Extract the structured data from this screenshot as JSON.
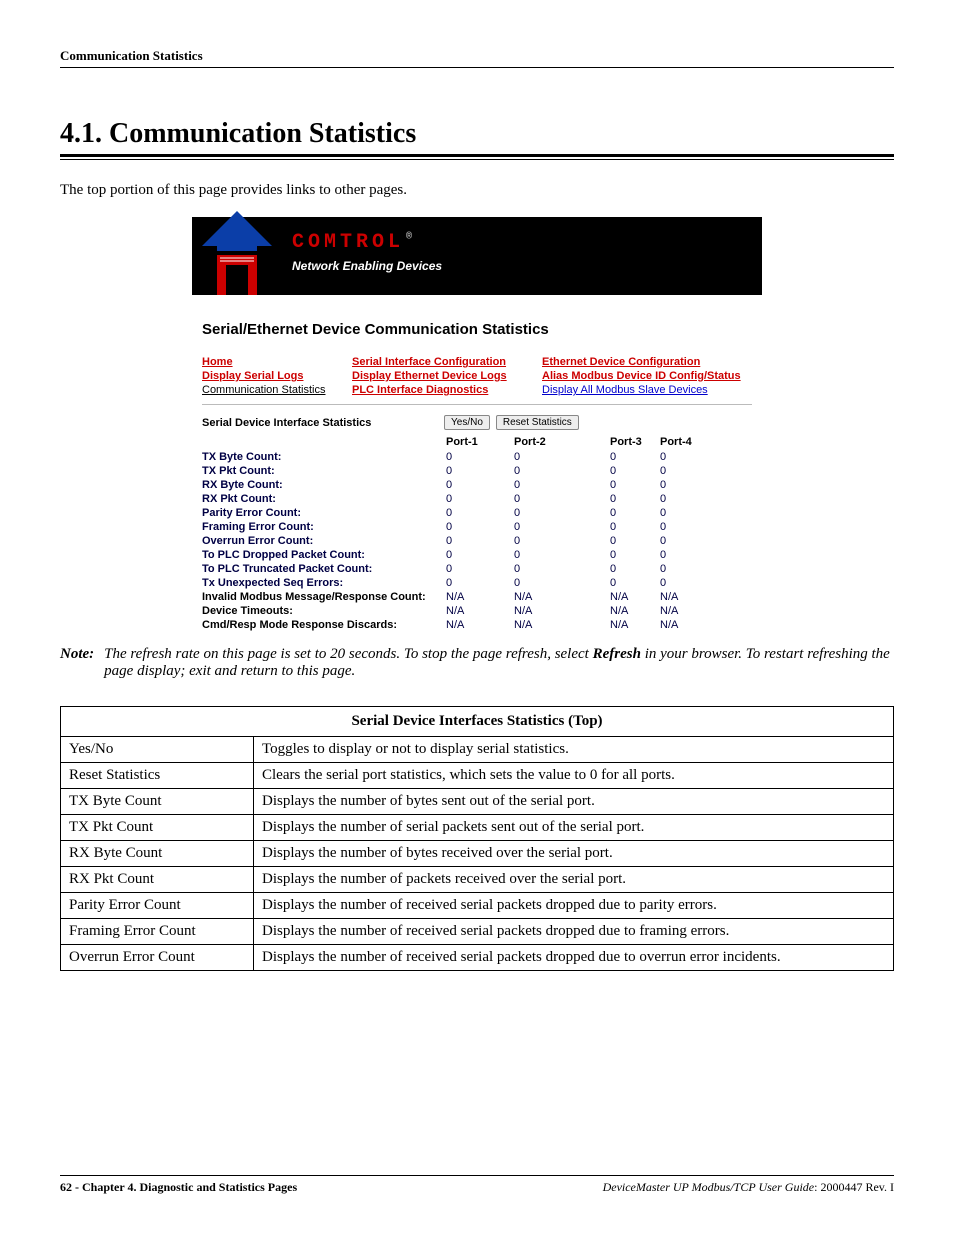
{
  "header": {
    "running_title": "Communication Statistics"
  },
  "section": {
    "number": "4.1.",
    "title": "Communication Statistics",
    "intro": "The top portion of this page provides links to other pages."
  },
  "screenshot": {
    "brand_text": "COMTROL",
    "brand_tagline": "Network Enabling Devices",
    "page_heading": "Serial/Ethernet Device Communication Statistics",
    "nav": {
      "home": "Home",
      "sic": "Serial Interface Configuration",
      "edc": "Ethernet Device Configuration",
      "dsl": "Display Serial Logs",
      "dedl": "Display Ethernet Device Logs",
      "amdi": "Alias Modbus Device ID Config/Status",
      "cs": "Communication Statistics",
      "pid": "PLC Interface Diagnostics",
      "damsd": "Display All Modbus Slave Devices"
    },
    "stats_title": "Serial Device Interface Statistics",
    "btn_yesno": "Yes/No",
    "btn_reset": "Reset Statistics",
    "ports": [
      "Port-1",
      "Port-2",
      "Port-3",
      "Port-4"
    ],
    "rows": [
      {
        "label": "TX Byte Count:",
        "v": [
          "0",
          "0",
          "0",
          "0"
        ]
      },
      {
        "label": "TX Pkt Count:",
        "v": [
          "0",
          "0",
          "0",
          "0"
        ]
      },
      {
        "label": "RX Byte Count:",
        "v": [
          "0",
          "0",
          "0",
          "0"
        ]
      },
      {
        "label": "RX Pkt Count:",
        "v": [
          "0",
          "0",
          "0",
          "0"
        ]
      },
      {
        "label": "Parity Error Count:",
        "v": [
          "0",
          "0",
          "0",
          "0"
        ]
      },
      {
        "label": "Framing Error Count:",
        "v": [
          "0",
          "0",
          "0",
          "0"
        ]
      },
      {
        "label": "Overrun Error Count:",
        "v": [
          "0",
          "0",
          "0",
          "0"
        ]
      },
      {
        "label": "To PLC Dropped Packet Count:",
        "v": [
          "0",
          "0",
          "0",
          "0"
        ]
      },
      {
        "label": "To PLC Truncated Packet Count:",
        "v": [
          "0",
          "0",
          "0",
          "0"
        ]
      },
      {
        "label": "Tx Unexpected Seq Errors:",
        "v": [
          "0",
          "0",
          "0",
          "0"
        ]
      },
      {
        "label": "Invalid Modbus Message/Response Count:",
        "v": [
          "N/A",
          "N/A",
          "N/A",
          "N/A"
        ]
      },
      {
        "label": "Device Timeouts:",
        "v": [
          "N/A",
          "N/A",
          "N/A",
          "N/A"
        ]
      },
      {
        "label": "Cmd/Resp Mode Response Discards:",
        "v": [
          "N/A",
          "N/A",
          "N/A",
          "N/A"
        ]
      }
    ]
  },
  "note": {
    "head": "Note:",
    "body_a": "The refresh rate on this page is set to 20 seconds. To stop the page refresh, select ",
    "body_bold": "Refresh",
    "body_b": " in your browser. To restart refreshing the page display; exit and return to this page."
  },
  "def_table": {
    "caption": "Serial Device Interfaces Statistics (Top)",
    "rows": [
      {
        "term": "Yes/No",
        "desc": "Toggles to display or not to display serial statistics."
      },
      {
        "term": "Reset Statistics",
        "desc": "Clears the serial port statistics, which sets the value to 0 for all ports."
      },
      {
        "term": "TX Byte Count",
        "desc": "Displays the number of bytes sent out of the serial port."
      },
      {
        "term": "TX Pkt Count",
        "desc": "Displays the number of serial packets sent out of the serial port."
      },
      {
        "term": "RX Byte Count",
        "desc": "Displays the number of bytes received over the serial port."
      },
      {
        "term": "RX Pkt Count",
        "desc": "Displays the number of packets received over the serial port."
      },
      {
        "term": "Parity Error Count",
        "desc": "Displays the number of received serial packets dropped due to parity errors."
      },
      {
        "term": "Framing Error Count",
        "desc": "Displays the number of received serial packets dropped due to framing errors."
      },
      {
        "term": "Overrun Error Count",
        "desc": "Displays the number of received serial packets dropped due to overrun error incidents."
      }
    ]
  },
  "footer": {
    "left_a": "62 - Chapter 4. Diagnostic and Statistics Pages",
    "right_title": "DeviceMaster UP Modbus/TCP User Guide",
    "right_rev": ": 2000447 Rev. I"
  }
}
